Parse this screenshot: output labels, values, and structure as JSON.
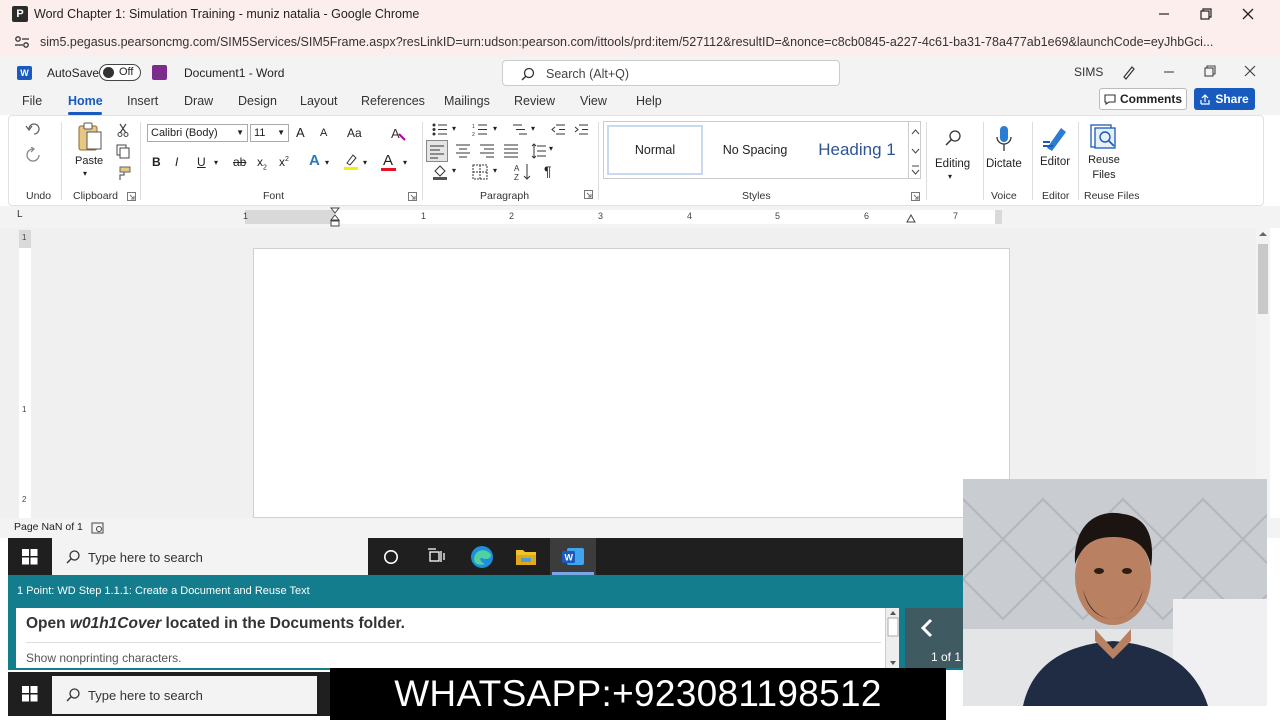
{
  "chrome": {
    "favicon_letter": "P",
    "window_title": "Word Chapter 1: Simulation Training - muniz natalia - Google Chrome",
    "url": "sim5.pegasus.pearsoncmg.com/SIM5Services/SIM5Frame.aspx?resLinkID=urn:udson:pearson.com/ittools/prd:item/527112&resultID=&nonce=c8cb0845-a227-4c61-ba31-78a477ab1e69&launchCode=eyJhbGci..."
  },
  "word": {
    "app_badge": "W",
    "autosave_label": "AutoSave",
    "autosave_state": "Off",
    "doc_title": "Document1 - Word",
    "search_placeholder": "Search (Alt+Q)",
    "user": "SIMS",
    "tabs": [
      "File",
      "Home",
      "Insert",
      "Draw",
      "Design",
      "Layout",
      "References",
      "Mailings",
      "Review",
      "View",
      "Help"
    ],
    "comments_label": "Comments",
    "share_label": "Share"
  },
  "ribbon": {
    "groups": {
      "undo": "Undo",
      "clipboard": "Clipboard",
      "font": "Font",
      "paragraph": "Paragraph",
      "styles": "Styles",
      "voice": "Voice",
      "editor": "Editor",
      "reuse_files": "Reuse Files"
    },
    "paste_label": "Paste",
    "font_name": "Calibri (Body)",
    "font_size": "11",
    "grow_font": "A",
    "shrink_font": "A",
    "change_case": "Aa",
    "bold": "B",
    "italic": "I",
    "underline": "U",
    "strikethrough": "ab",
    "subscript": "x",
    "superscript": "x",
    "text_effects": "A",
    "font_color": "A",
    "pilcrow": "¶",
    "styles": [
      "Normal",
      "No Spacing",
      "Heading 1"
    ],
    "editing_label": "Editing",
    "dictate_label": "Dictate",
    "editor_label": "Editor",
    "reuse_files_label": "Reuse Files"
  },
  "ruler": {
    "numbers": [
      "1",
      "1",
      "2",
      "3",
      "4",
      "5",
      "6",
      "7"
    ],
    "vertical_numbers": [
      "1",
      "1",
      "2"
    ]
  },
  "status": {
    "page": "Page NaN of 1"
  },
  "taskbar": {
    "search_placeholder": "Type here to search"
  },
  "sim": {
    "step": "1 Point: WD Step 1.1.1: Create a Document and Reuse Text",
    "instruction_prefix": "Open ",
    "instruction_file": "w01h1Cover",
    "instruction_suffix": " located in the Documents folder.",
    "sub_instruction": "Show nonprinting characters.",
    "page_count": "1 of 1"
  },
  "banner": {
    "text": "WHATSAPP:+923081198512"
  },
  "colors": {
    "word_blue": "#185abd",
    "sim_teal": "#137c8d",
    "taskbar": "#1f1f1f"
  }
}
